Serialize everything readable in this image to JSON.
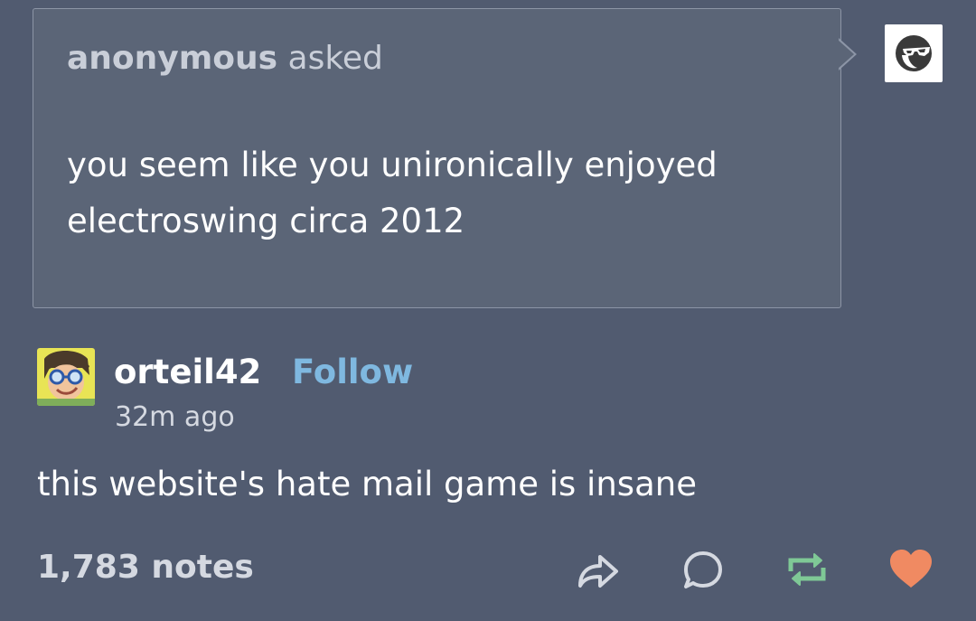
{
  "ask": {
    "asker_name": "anonymous",
    "asker_verb": "asked",
    "question": "you seem like you unironically enjoyed electroswing circa 2012",
    "asker_avatar_icon": "sunglasses-face-icon"
  },
  "post": {
    "username": "orteil42",
    "follow_label": "Follow",
    "timestamp": "32m ago",
    "text": "this website's hate mail game is insane",
    "notes": "1,783 notes"
  },
  "actions": {
    "share_icon": "share-arrow-icon",
    "reply_icon": "speech-bubble-icon",
    "reblog_icon": "reblog-icon",
    "like_icon": "heart-icon"
  },
  "colors": {
    "background": "#515b70",
    "ask_background": "#5b6577",
    "follow": "#7fb8e0",
    "reblog": "#7fc896",
    "like": "#f08a62"
  }
}
